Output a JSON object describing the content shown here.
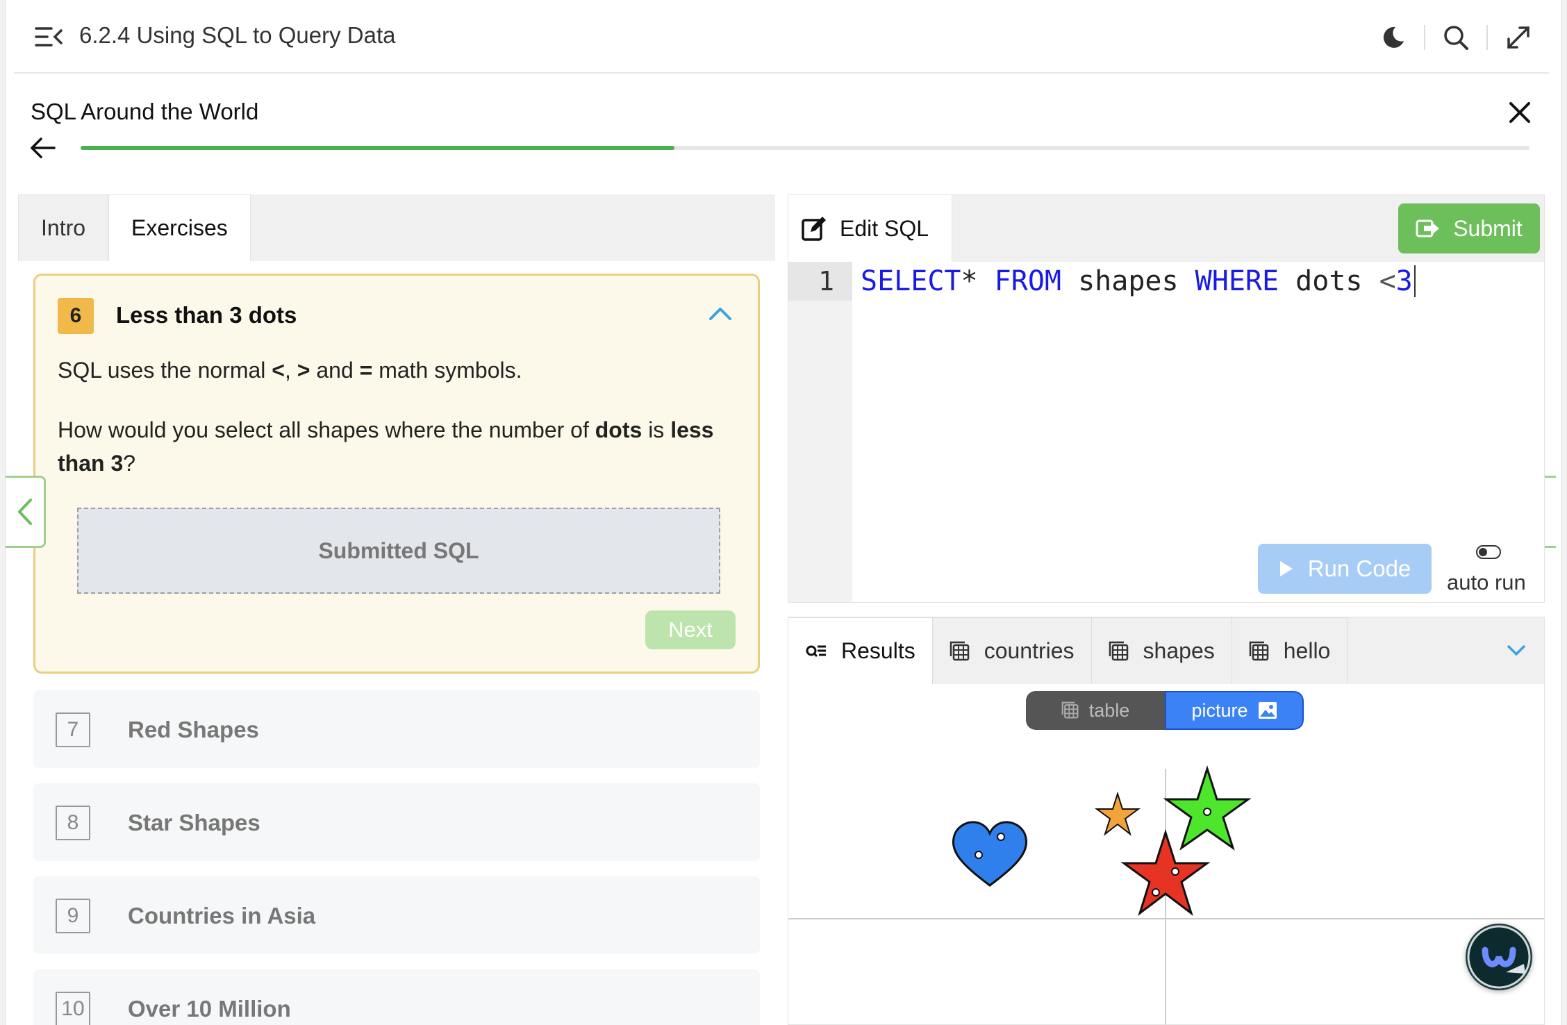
{
  "topbar": {
    "breadcrumb": "6.2.4 Using SQL to Query Data",
    "icons": [
      "menu-collapse-icon",
      "moon-icon",
      "search-icon",
      "expand-icon"
    ]
  },
  "lesson": {
    "title": "SQL Around the World",
    "progress_fraction": 0.41
  },
  "left_tabs": [
    "Intro",
    "Exercises"
  ],
  "current_exercise": {
    "number": "6",
    "title": "Less than 3 dots",
    "line1_pre": "SQL uses the normal ",
    "sym1": "<",
    "comma1": ", ",
    "sym2": ">",
    "line1_mid": " and ",
    "sym3": "=",
    "line1_post": " math symbols.",
    "q_pre": "How would you select all shapes where the number of ",
    "q_b1": "dots",
    "q_mid": " is ",
    "q_b2": "less than 3",
    "q_post": "?",
    "submitted_label": "Submitted SQL",
    "next_label": "Next"
  },
  "exercises": [
    {
      "number": "7",
      "title": "Red Shapes"
    },
    {
      "number": "8",
      "title": "Star Shapes"
    },
    {
      "number": "9",
      "title": "Countries in Asia"
    },
    {
      "number": "10",
      "title": "Over 10 Million"
    }
  ],
  "editor": {
    "tab_label": "Edit SQL",
    "submit_label": "Submit",
    "line_number": "1",
    "code": {
      "kw1": "SELECT",
      "t1": "* ",
      "kw2": "FROM",
      "t2": " shapes ",
      "kw3": "WHERE",
      "t3": " dots ",
      "op": "<",
      "num": "3"
    },
    "run_label": "Run Code",
    "auto_run_label": "auto run"
  },
  "results": {
    "tabs": [
      "Results",
      "countries",
      "shapes",
      "hello"
    ],
    "view_table": "table",
    "view_picture": "picture"
  },
  "colors": {
    "accent_green": "#6cbf5a",
    "progress": "#4caf50",
    "run_blue": "#a7cdf7",
    "exercise_bg": "#fdf9ea"
  }
}
